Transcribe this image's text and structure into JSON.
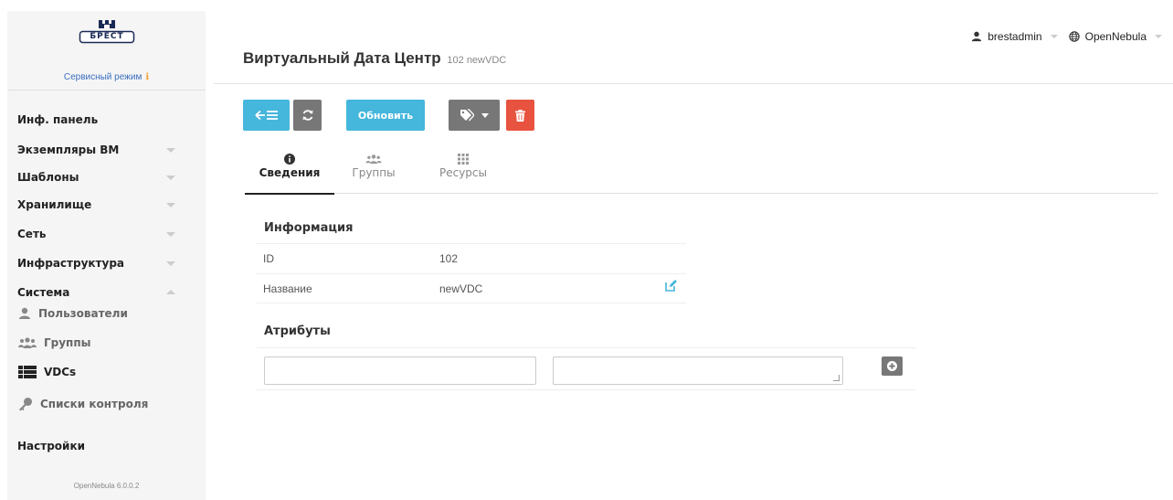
{
  "sidebar": {
    "logo_text": "БРЕСТ",
    "service_mode": "Сервисный режим",
    "menu": [
      {
        "label": "Инф. панель"
      },
      {
        "label": "Экземпляры ВМ"
      },
      {
        "label": "Шаблоны"
      },
      {
        "label": "Хранилище"
      },
      {
        "label": "Сеть"
      },
      {
        "label": "Инфраструктура"
      },
      {
        "label": "Система"
      }
    ],
    "submenu": [
      {
        "label": "Пользователи",
        "icon": "user-icon"
      },
      {
        "label": "Группы",
        "icon": "users-icon"
      },
      {
        "label": "VDCs",
        "icon": "th-list-icon"
      },
      {
        "label": "Списки контроля",
        "icon": "key-icon"
      }
    ],
    "settings": "Настройки",
    "version": "OpenNebula 6.0.0.2"
  },
  "header": {
    "title": "Виртуальный Дата Центр",
    "subtitle": "102 newVDC",
    "user": "brestadmin",
    "zone": "OpenNebula"
  },
  "toolbar": {
    "update_label": "Обновить"
  },
  "tabs": [
    {
      "label": "Сведения",
      "icon": "info-icon",
      "active": true
    },
    {
      "label": "Группы",
      "icon": "users-icon",
      "active": false
    },
    {
      "label": "Ресурсы",
      "icon": "grid-icon",
      "active": false
    }
  ],
  "info": {
    "title": "Информация",
    "rows": [
      {
        "key": "ID",
        "value": "102"
      },
      {
        "key": "Название",
        "value": "newVDC"
      }
    ]
  },
  "attributes": {
    "title": "Атрибуты",
    "key_value": "",
    "value_value": ""
  },
  "colors": {
    "accent": "#45b6dc",
    "danger": "#e8533f",
    "neutral": "#777777",
    "link": "#3a6ebf"
  }
}
